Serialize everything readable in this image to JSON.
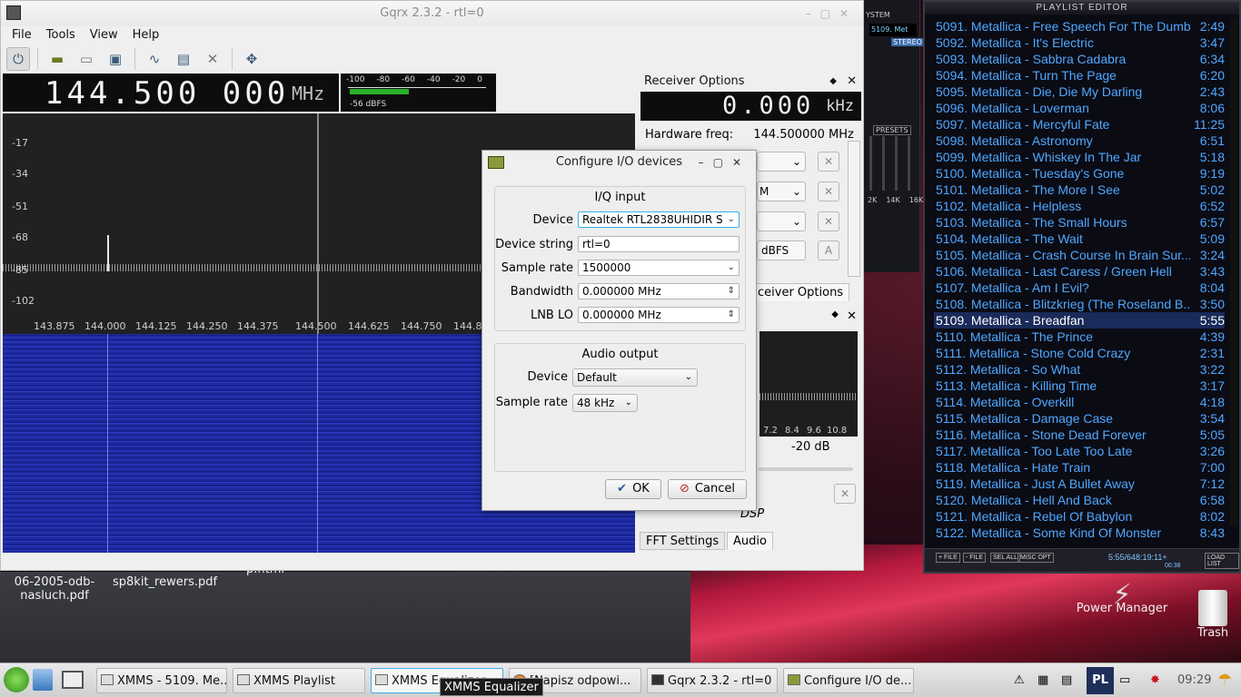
{
  "gqrx": {
    "title": "Gqrx 2.3.2 - rtl=0",
    "menu": [
      "File",
      "Tools",
      "View",
      "Help"
    ],
    "frequency": "144.500 000",
    "frequency_unit": "MHz",
    "meter_scale": [
      "-100",
      "-80",
      "-60",
      "-40",
      "-20",
      "0"
    ],
    "meter_level_fraction": 0.43,
    "meter_value": "-56 dBFS",
    "spectrum_y_labels": [
      "-17",
      "-34",
      "-51",
      "-68",
      "-85",
      "-102"
    ],
    "spectrum_x_labels": [
      "143.875",
      "144.000",
      "144.125",
      "144.250",
      "144.375",
      "144.500",
      "144.625",
      "144.750",
      "144.8"
    ],
    "receiver_options": {
      "header": "Receiver Options",
      "offset": "0.000",
      "offset_unit": "kHz",
      "hw_label": "Hardware freq:",
      "hw_value": "144.500000 MHz",
      "squelch_unit": "dBFS",
      "auto_button": "A",
      "tab_label": "ceiver Options"
    },
    "fft_panel": {
      "x_labels": [
        "7.2",
        "8.4",
        "9.6",
        "10.8"
      ],
      "gain": "-20 dB",
      "dsp_label": "DSP"
    },
    "bottom_tabs": [
      "FFT Settings",
      "Audio"
    ]
  },
  "dialog": {
    "title": "Configure I/O devices",
    "iq_group": "I/Q input",
    "device_label": "Device",
    "device_value": "Realtek RTL2838UHIDIR S",
    "devstr_label": "Device string",
    "devstr_value": "rtl=0",
    "rate_label": "Sample rate",
    "rate_value": "1500000",
    "bw_label": "Bandwidth",
    "bw_value": "0.000000 MHz",
    "lnb_label": "LNB LO",
    "lnb_value": "0.000000 MHz",
    "audio_group": "Audio output",
    "audio_device_label": "Device",
    "audio_device_value": "Default",
    "audio_rate_label": "Sample rate",
    "audio_rate_value": "48 kHz",
    "ok": "OK",
    "cancel": "Cancel"
  },
  "playlist": {
    "title": "PLAYLIST EDITOR",
    "items": [
      {
        "t": "5091. Metallica - Free Speech For The Dumb",
        "d": "2:49"
      },
      {
        "t": "5092. Metallica - It's Electric",
        "d": "3:47"
      },
      {
        "t": "5093. Metallica - Sabbra Cadabra",
        "d": "6:34"
      },
      {
        "t": "5094. Metallica - Turn The Page",
        "d": "6:20"
      },
      {
        "t": "5095. Metallica - Die, Die My Darling",
        "d": "2:43"
      },
      {
        "t": "5096. Metallica - Loverman",
        "d": "8:06"
      },
      {
        "t": "5097. Metallica - Mercyful Fate",
        "d": "11:25"
      },
      {
        "t": "5098. Metallica - Astronomy",
        "d": "6:51"
      },
      {
        "t": "5099. Metallica - Whiskey In The Jar",
        "d": "5:18"
      },
      {
        "t": "5100. Metallica - Tuesday's Gone",
        "d": "9:19"
      },
      {
        "t": "5101. Metallica - The More I See",
        "d": "5:02"
      },
      {
        "t": "5102. Metallica - Helpless",
        "d": "6:52"
      },
      {
        "t": "5103. Metallica - The Small Hours",
        "d": "6:57"
      },
      {
        "t": "5104. Metallica - The Wait",
        "d": "5:09"
      },
      {
        "t": "5105. Metallica - Crash Course In Brain Sur...",
        "d": "3:24"
      },
      {
        "t": "5106. Metallica - Last Caress / Green Hell",
        "d": "3:43"
      },
      {
        "t": "5107. Metallica - Am I Evil?",
        "d": "8:04"
      },
      {
        "t": "5108. Metallica - Blitzkrieg (The Roseland B...",
        "d": "3:50"
      },
      {
        "t": "5109. Metallica - Breadfan",
        "d": "5:55"
      },
      {
        "t": "5110. Metallica - The Prince",
        "d": "4:39"
      },
      {
        "t": "5111. Metallica - Stone Cold Crazy",
        "d": "2:31"
      },
      {
        "t": "5112. Metallica - So What",
        "d": "3:22"
      },
      {
        "t": "5113. Metallica - Killing Time",
        "d": "3:17"
      },
      {
        "t": "5114. Metallica - Overkill",
        "d": "4:18"
      },
      {
        "t": "5115. Metallica - Damage Case",
        "d": "3:54"
      },
      {
        "t": "5116. Metallica - Stone Dead Forever",
        "d": "5:05"
      },
      {
        "t": "5117. Metallica - Too Late Too Late",
        "d": "3:26"
      },
      {
        "t": "5118. Metallica - Hate Train",
        "d": "7:00"
      },
      {
        "t": "5119. Metallica - Just A Bullet Away",
        "d": "7:12"
      },
      {
        "t": "5120. Metallica - Hell And Back",
        "d": "6:58"
      },
      {
        "t": "5121. Metallica - Rebel Of Babylon",
        "d": "8:02"
      },
      {
        "t": "5122. Metallica - Some Kind Of Monster",
        "d": "8:43"
      }
    ],
    "current_index": 18,
    "buttons": [
      "+ FILE",
      "- FILE",
      "SEL ALL",
      "MISC OPT",
      "LOAD LIST"
    ],
    "time_display": "5:55/648:19:11+",
    "time_small": "00:38"
  },
  "xmms": {
    "display": "5109. Met",
    "stereo": "STEREO",
    "system": "YSTEM",
    "presets": "PRESETS",
    "eq_labels": [
      "2K",
      "14K",
      "16K"
    ]
  },
  "desktop": {
    "icon1": "06-2005-odb-nasluch.pdf",
    "icon2": "sp8kit_rewers.pdf",
    "icon3": "p.html",
    "power_manager": "Power Manager",
    "trash": "Trash"
  },
  "taskbar": {
    "tasks": [
      "XMMS - 5109. Me...",
      "XMMS Playlist",
      "XMMS Equalizer",
      "[Napisz odpowi...",
      "Gqrx 2.3.2 - rtl=0",
      "Configure I/O de..."
    ],
    "lang": "PL",
    "clock": "09:29",
    "tooltip": "XMMS Equalizer"
  }
}
